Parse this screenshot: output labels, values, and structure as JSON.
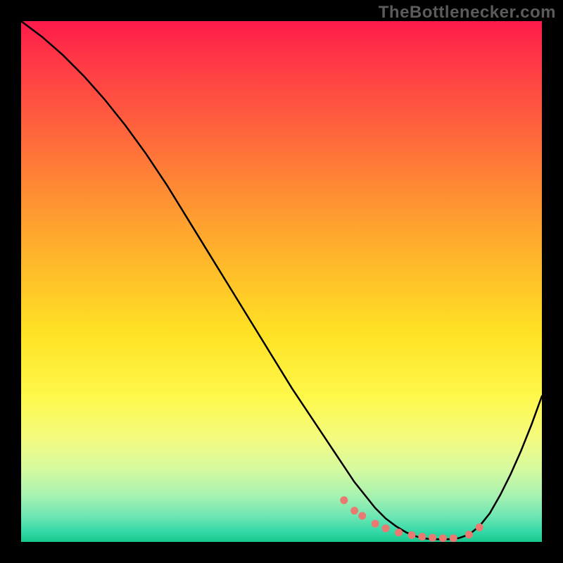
{
  "watermark": "TheBottleneсker.com",
  "chart_data": {
    "type": "line",
    "title": "",
    "xlabel": "",
    "ylabel": "",
    "xlim": [
      0,
      100
    ],
    "ylim": [
      0,
      100
    ],
    "series": [
      {
        "name": "curve",
        "x": [
          0,
          4,
          8,
          12,
          16,
          20,
          24,
          28,
          32,
          36,
          40,
          44,
          48,
          52,
          56,
          60,
          62,
          64,
          66,
          68,
          70,
          72,
          74,
          76,
          78,
          80,
          82,
          84,
          86,
          88,
          90,
          92,
          94,
          96,
          98,
          100
        ],
        "y": [
          100,
          97,
          93.5,
          89.5,
          85,
          80,
          74.5,
          68.5,
          62,
          55.5,
          49,
          42.5,
          36,
          29.5,
          23.5,
          17.5,
          14.5,
          11.5,
          9,
          6.5,
          4.5,
          3,
          1.8,
          1,
          0.6,
          0.5,
          0.5,
          0.7,
          1.4,
          3,
          5.5,
          9,
          13,
          17.5,
          22.5,
          28
        ]
      }
    ],
    "markers": {
      "name": "dots",
      "x": [
        62,
        64,
        65.5,
        68,
        70,
        72.5,
        75,
        77,
        79,
        81,
        83,
        86,
        88
      ],
      "y": [
        8,
        6,
        5,
        3.5,
        2.6,
        1.8,
        1.3,
        1,
        0.8,
        0.7,
        0.7,
        1.4,
        2.8
      ]
    },
    "gradient_stops": [
      {
        "pct": 0,
        "color": "#ff1a4b"
      },
      {
        "pct": 6,
        "color": "#ff3347"
      },
      {
        "pct": 18,
        "color": "#ff5a3f"
      },
      {
        "pct": 32,
        "color": "#ff8a34"
      },
      {
        "pct": 46,
        "color": "#ffb72a"
      },
      {
        "pct": 60,
        "color": "#ffe224"
      },
      {
        "pct": 72,
        "color": "#fef84a"
      },
      {
        "pct": 80,
        "color": "#f4fb7e"
      },
      {
        "pct": 86,
        "color": "#d6faa0"
      },
      {
        "pct": 91,
        "color": "#a8f2b0"
      },
      {
        "pct": 95,
        "color": "#6fe6b3"
      },
      {
        "pct": 98,
        "color": "#34d9a8"
      },
      {
        "pct": 100,
        "color": "#17c98e"
      }
    ]
  }
}
